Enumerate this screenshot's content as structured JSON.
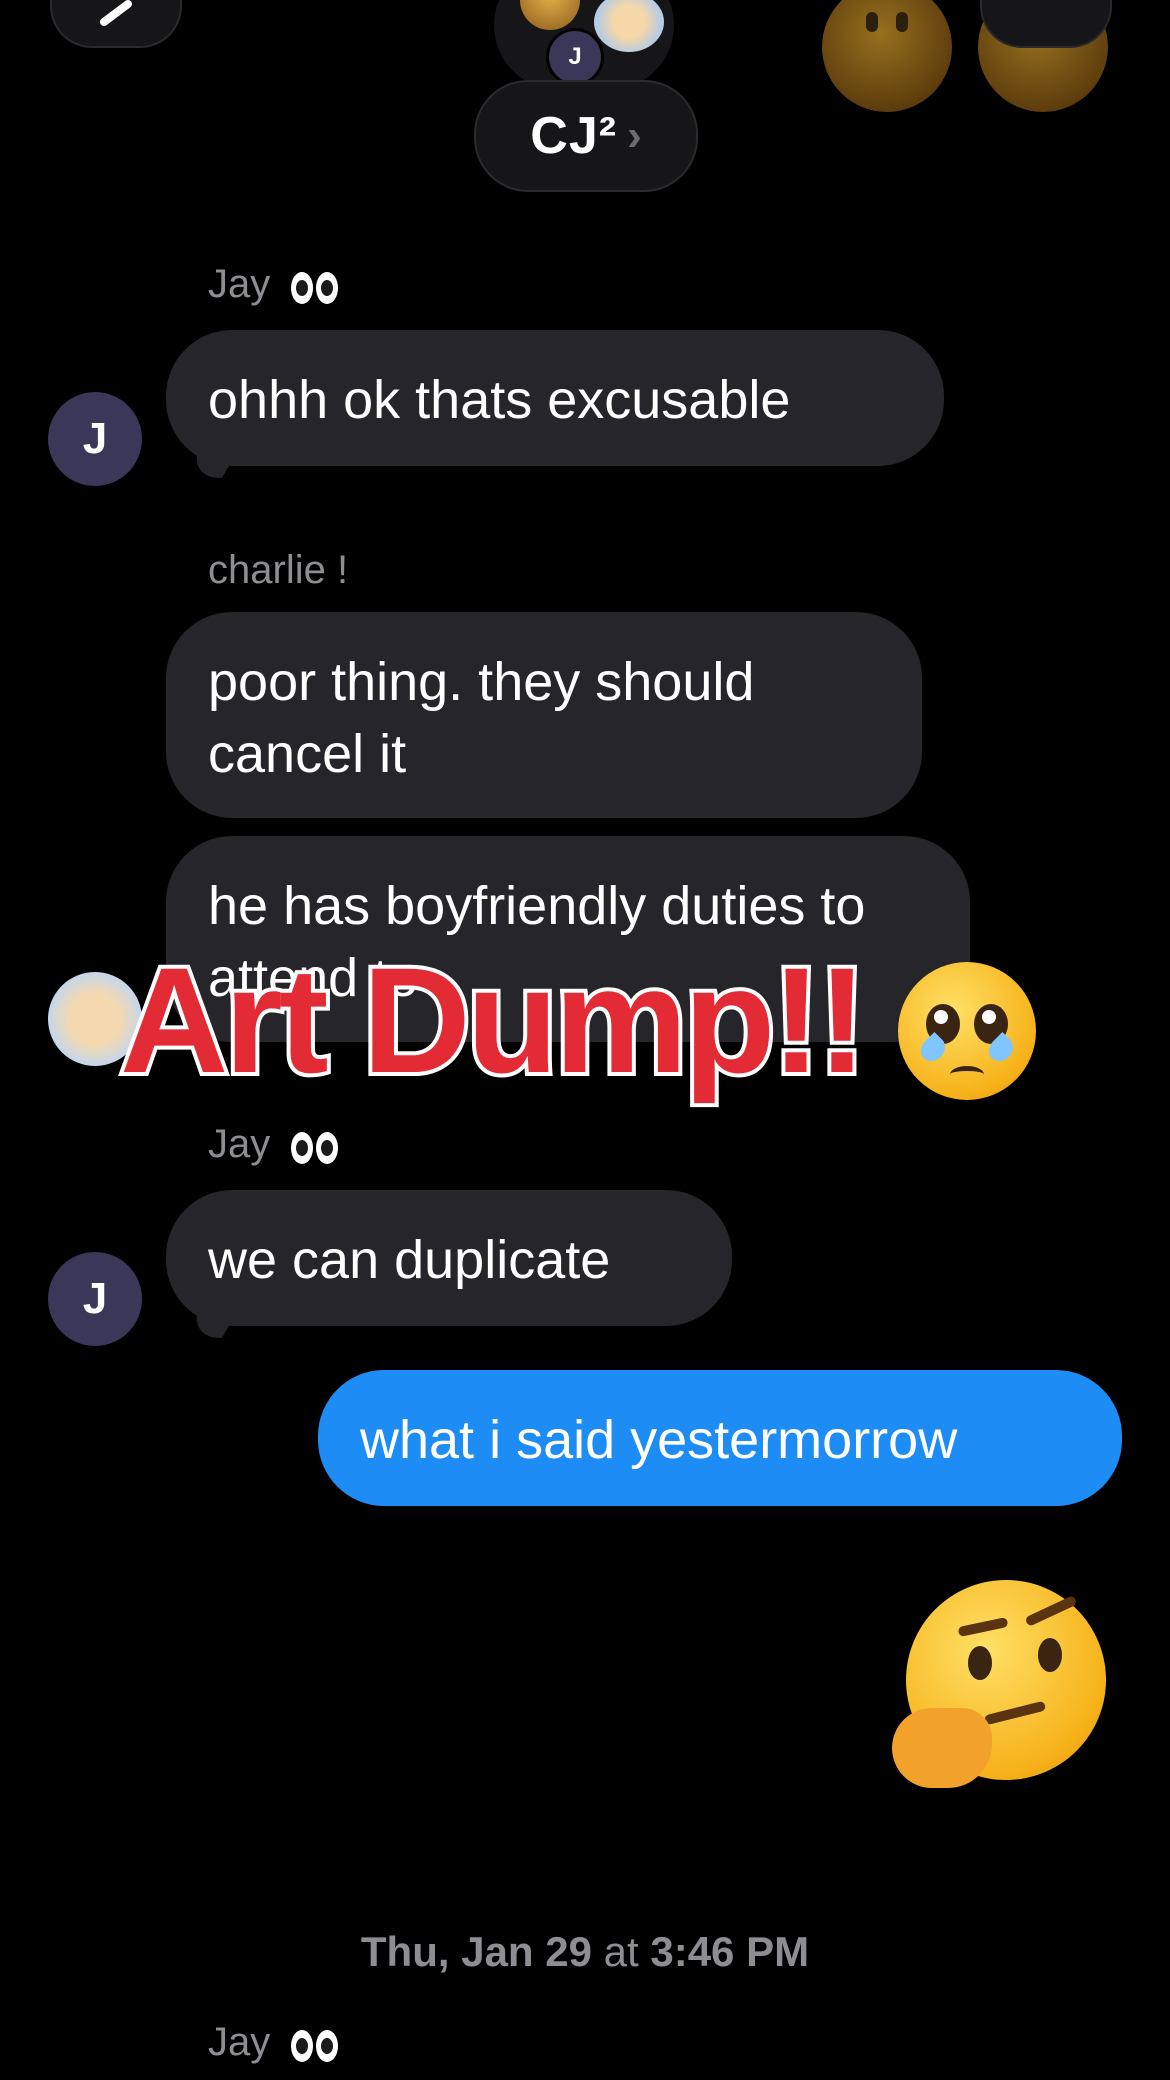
{
  "header": {
    "group_title": "CJ²",
    "title_chevron": "›",
    "mini_avatar_initial": "J"
  },
  "messages": [
    {
      "sender": "Jay",
      "text": "ohhh ok thats excusable"
    },
    {
      "sender": "charlie !",
      "text": "poor thing. they should cancel it"
    },
    {
      "text": "he has boyfriendly duties to attend to"
    },
    {
      "sender": "Jay",
      "text": "we can duplicate"
    },
    {
      "from_me": true,
      "text": "what i said yestermorrow"
    }
  ],
  "avatar_initial": "J",
  "overlay": {
    "title": "Art Dump!!"
  },
  "reaction_emoji": "thinking-face",
  "overlay_emoji": "pleading-teary-face",
  "timestamp": {
    "date": "Thu, Jan 29",
    "at": "at",
    "time": "3:46 PM"
  },
  "last_sender": "Jay",
  "colors": {
    "background": "#000000",
    "incoming_bubble": "#26262a",
    "outgoing_bubble": "#1e8cf5",
    "title_red": "#e32b36"
  }
}
